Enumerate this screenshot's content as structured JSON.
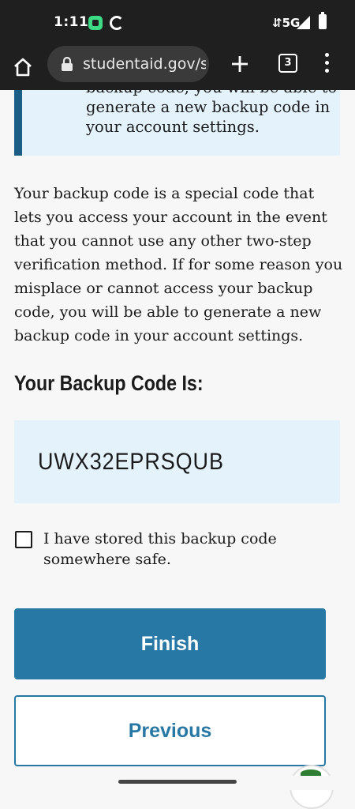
{
  "status_bar": {
    "time": "1:11",
    "network": "⇵5G",
    "icons": [
      "app-notification-icon",
      "sync-icon",
      "signal-icon",
      "battery-icon"
    ]
  },
  "browser": {
    "url": "studentaid.gov/s",
    "tab_count": "3",
    "icons": [
      "home-icon",
      "lock-icon",
      "plus-icon",
      "more-vert-icon"
    ]
  },
  "alert": {
    "text": "backup code, you will be able to generate a new backup code in your account settings."
  },
  "main": {
    "paragraph": "Your backup code is a special code that lets you access your account in the event that you cannot use any other two-step verification method. If for some reason you misplace or cannot access your backup code, you will be able to generate a new backup code in your account settings.",
    "code_heading": "Your Backup Code Is:",
    "code_value": "UWX32EPRSQUB",
    "checkbox_label": "I have stored this backup code somewhere safe.",
    "checkbox_checked": false,
    "finish_label": "Finish",
    "previous_label": "Previous"
  },
  "colors": {
    "primary": "#2778a5",
    "alert_border": "#1a5e86",
    "alert_bg": "#e3f2fb",
    "chrome_bg": "#1f1f1f"
  }
}
